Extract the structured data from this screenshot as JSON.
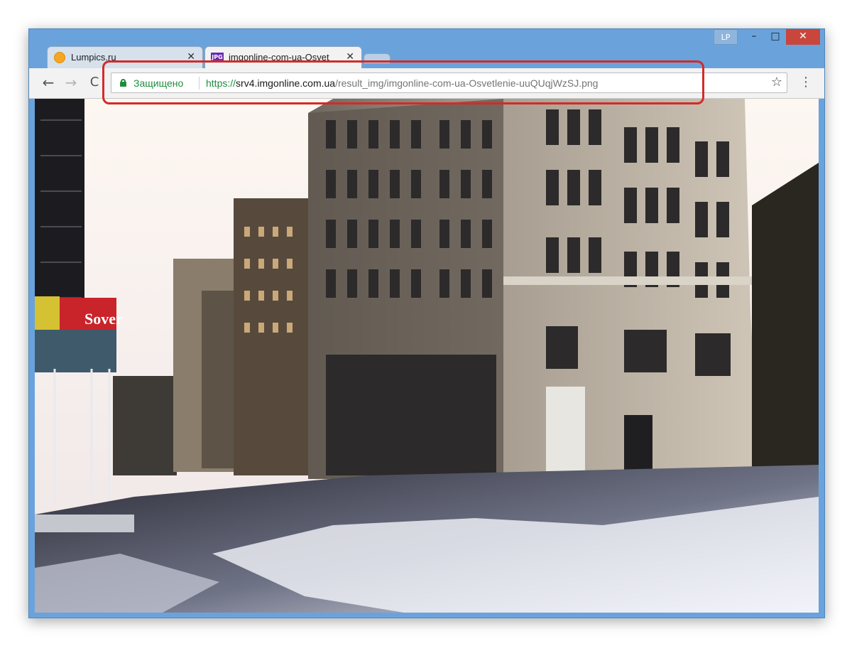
{
  "window": {
    "profile_badge": "LP",
    "controls": {
      "minimize": "–",
      "maximize": "□",
      "close": "✕"
    }
  },
  "tabs": [
    {
      "title": "Lumpics.ru",
      "favicon": "orange-circle-icon",
      "close": "✕",
      "active": false
    },
    {
      "title": "imgonline-com-ua-Osvet",
      "favicon": "jpg-file-icon",
      "favicon_text": "JPG",
      "close": "✕",
      "active": true
    }
  ],
  "toolbar": {
    "back": "←",
    "forward": "→",
    "reload": "C",
    "menu": "⋮",
    "bookmark": "☆"
  },
  "address_bar": {
    "secure_label": "Защищено",
    "url_scheme": "https://",
    "url_host": "srv4.imgonline.com.ua",
    "url_path": "/result_img/imgonline-com-ua-Osvetlenie-uuQUqjWzSJ.png"
  },
  "colors": {
    "window_frame": "#6aa3dc",
    "highlight": "#d42a2a",
    "secure_green": "#1e8e3e"
  },
  "content": {
    "sign_text": "Sover"
  }
}
